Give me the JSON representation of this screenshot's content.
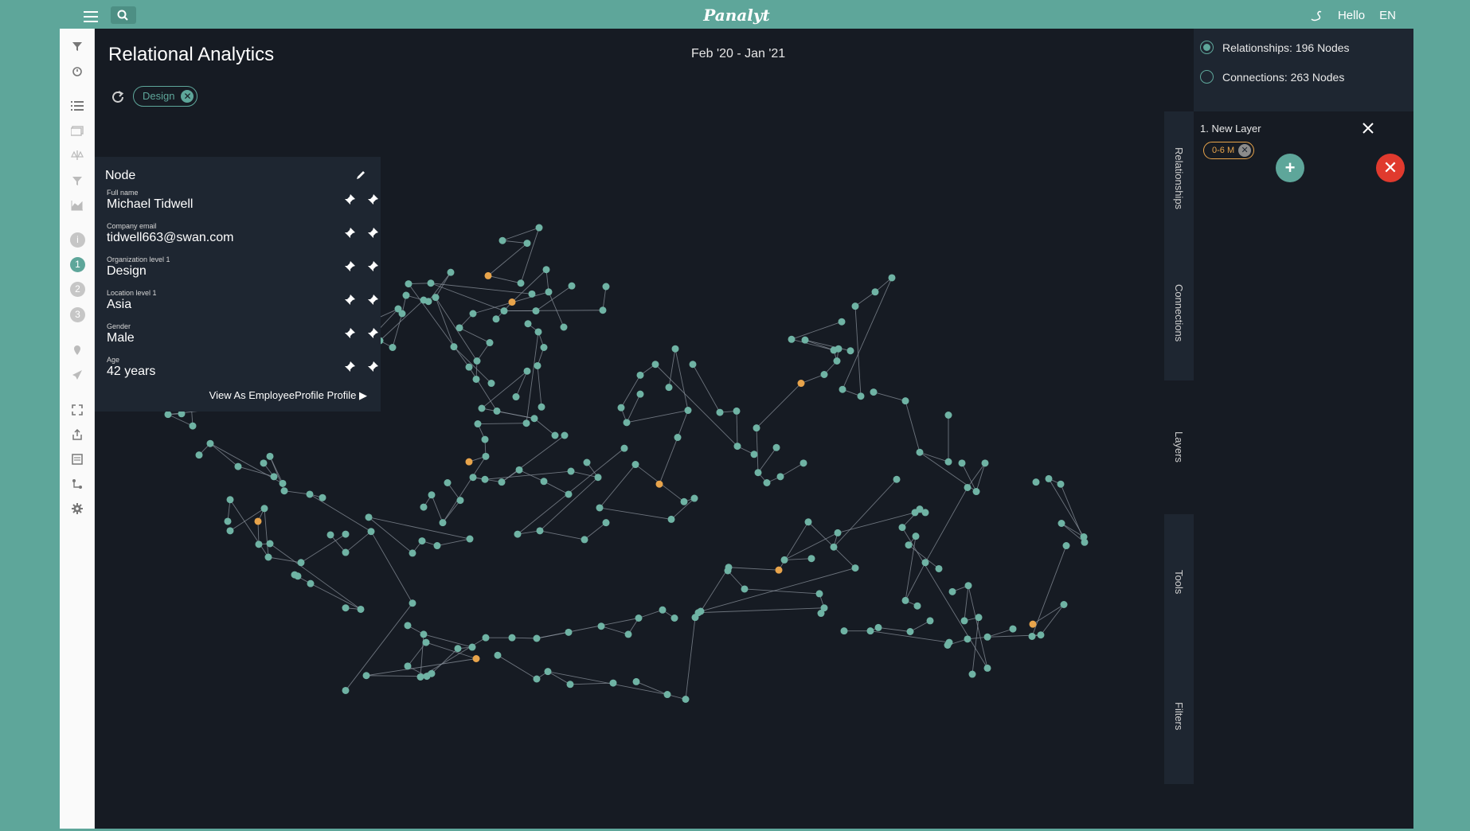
{
  "app": {
    "logo": "Panalyt",
    "greeting": "Hello",
    "language": "EN"
  },
  "page": {
    "title": "Relational Analytics",
    "date_range": "Feb '20 - Jan '21"
  },
  "filter_chip": {
    "label": "Design"
  },
  "nav_steps": [
    "1",
    "2",
    "3"
  ],
  "node_panel": {
    "header": "Node",
    "fields": [
      {
        "label": "Full name",
        "value": "Michael Tidwell"
      },
      {
        "label": "Company email",
        "value": "tidwell663@swan.com"
      },
      {
        "label": "Organization level 1",
        "value": "Design"
      },
      {
        "label": "Location level 1",
        "value": "Asia"
      },
      {
        "label": "Gender",
        "value": "Male"
      },
      {
        "label": "Age",
        "value": "42 years"
      }
    ],
    "profile_link": "View As EmployeeProfile Profile ▶"
  },
  "graph_options": {
    "relationships": "Relationships: 196 Nodes",
    "connections": "Connections: 263 Nodes",
    "selected": "relationships"
  },
  "side_tabs": [
    "Relationships",
    "Connections",
    "Layers",
    "Tools",
    "Filters"
  ],
  "active_tab": "Layers",
  "layer": {
    "name": "1. New Layer",
    "chip": "0-6 M"
  },
  "colors": {
    "accent": "#5ea69a",
    "background": "#161b23",
    "panel": "#1e2631",
    "node": "#6fb3a4",
    "node_highlight": "#e8a44b",
    "selected_node": "#1010e0",
    "selected_neighbor": "#e03a2e",
    "danger": "#e03a2e"
  }
}
